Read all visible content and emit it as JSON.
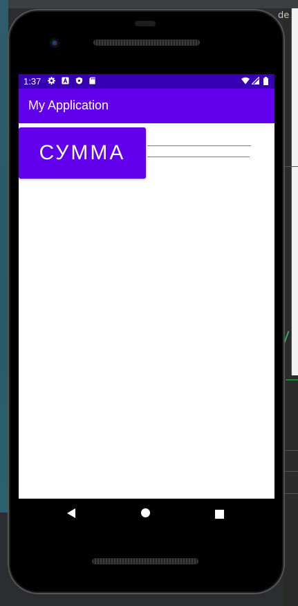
{
  "ide": {
    "right_text": "de"
  },
  "status_bar": {
    "time": "1:37"
  },
  "app": {
    "title": "My Application"
  },
  "main": {
    "sum_button_label": "СУММА",
    "fields": [
      {
        "name": "first-number-field",
        "value": ""
      },
      {
        "name": "second-number-field",
        "value": ""
      }
    ]
  },
  "colors": {
    "status_bar": "#3700b3",
    "primary": "#6200ee"
  },
  "icons": {
    "status": [
      "settings-icon",
      "a-icon",
      "shield-icon",
      "sd-card-icon",
      "wifi-icon",
      "signal-icon",
      "battery-icon"
    ],
    "nav": [
      "back-icon",
      "home-icon",
      "recents-icon"
    ]
  }
}
